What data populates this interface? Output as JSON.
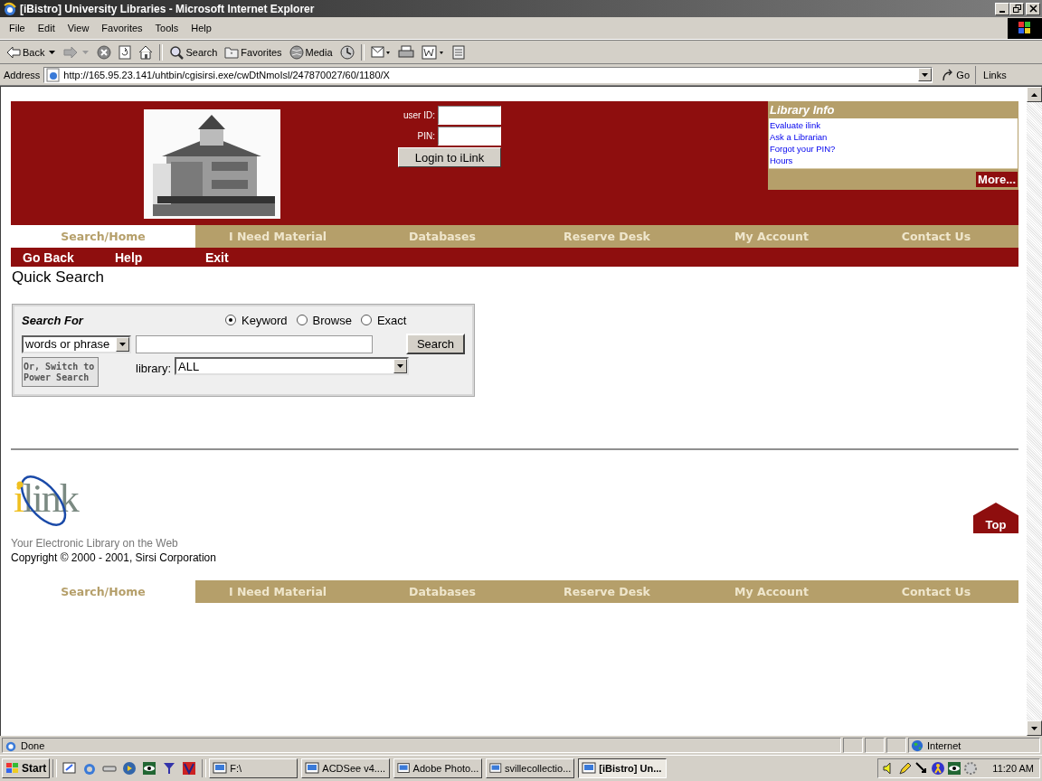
{
  "window": {
    "title": "[iBistro] University Libraries - Microsoft Internet Explorer"
  },
  "menu": [
    "File",
    "Edit",
    "View",
    "Favorites",
    "Tools",
    "Help"
  ],
  "toolbar": [
    {
      "kind": "back",
      "label": "Back"
    },
    {
      "kind": "forward"
    },
    {
      "kind": "stop"
    },
    {
      "kind": "refresh"
    },
    {
      "kind": "home"
    },
    {
      "kind": "search",
      "label": "Search"
    },
    {
      "kind": "favorites",
      "label": "Favorites"
    },
    {
      "kind": "media",
      "label": "Media"
    },
    {
      "kind": "history"
    },
    {
      "kind": "mail"
    },
    {
      "kind": "print"
    },
    {
      "kind": "edit"
    },
    {
      "kind": "discuss"
    }
  ],
  "address": {
    "label": "Address",
    "url": "http://165.95.23.141/uhtbin/cgisirsi.exe/cwDtNmoIsl/247870027/60/1180/X",
    "go": "Go",
    "links": "Links"
  },
  "login": {
    "user_label": "user ID:",
    "pin_label": "PIN:",
    "button": "Login to iLink"
  },
  "library_info": {
    "title": "Library Info",
    "links": [
      "Evaluate ilink",
      "Ask a Librarian",
      "Forgot your PIN?",
      "Hours"
    ],
    "more": "More..."
  },
  "nav_tabs": [
    {
      "label": "Search/Home",
      "selected": true
    },
    {
      "label": "I Need Material",
      "selected": false
    },
    {
      "label": "Databases",
      "selected": false
    },
    {
      "label": "Reserve Desk",
      "selected": false
    },
    {
      "label": "My Account",
      "selected": false
    },
    {
      "label": "Contact Us",
      "selected": false
    }
  ],
  "sub_nav": [
    "Go Back",
    "Help",
    "Exit"
  ],
  "heading": "Quick Search",
  "search_form": {
    "title": "Search For",
    "modes": [
      {
        "label": "Keyword",
        "selected": true
      },
      {
        "label": "Browse",
        "selected": false
      },
      {
        "label": "Exact",
        "selected": false
      }
    ],
    "type": "words or phrase",
    "button": "Search",
    "power_search": "Or, Switch to Power Search",
    "library_label": "library:",
    "library": "ALL"
  },
  "footer": {
    "logo": "ilink",
    "tagline": "Your Electronic Library on the Web",
    "copyright": "Copyright © 2000 - 2001, Sirsi Corporation",
    "top": "Top"
  },
  "bottom_tabs": [
    {
      "label": "Search/Home",
      "selected": true
    },
    {
      "label": "I Need Material",
      "selected": false
    },
    {
      "label": "Databases",
      "selected": false
    },
    {
      "label": "Reserve Desk",
      "selected": false
    },
    {
      "label": "My Account",
      "selected": false
    },
    {
      "label": "Contact Us",
      "selected": false
    }
  ],
  "status_bar": {
    "text": "Done",
    "zone": "Internet"
  },
  "taskbar": {
    "start": "Start",
    "tasks": [
      {
        "label": "F:\\",
        "selected": false
      },
      {
        "label": "ACDSee v4....",
        "selected": false
      },
      {
        "label": "Adobe Photo...",
        "selected": false
      },
      {
        "label": "svillecollectio...",
        "selected": false
      },
      {
        "label": "[iBistro] Un...",
        "selected": true
      }
    ],
    "clock": "11:20 AM"
  }
}
